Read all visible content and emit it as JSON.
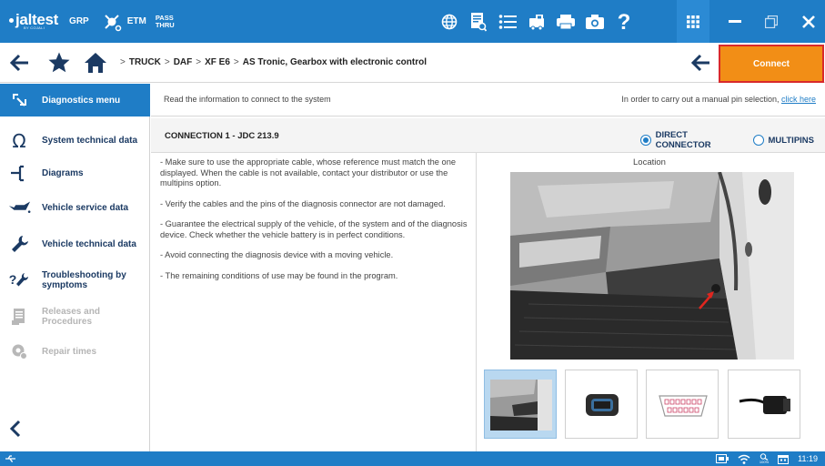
{
  "topbar": {
    "logo_text": "jaltest",
    "logo_sub": "BY COJALI",
    "grp_label": "GRP",
    "etm_label": "ETM",
    "pass_line1": "PASS",
    "pass_line2": "THRU",
    "accent": "#1f7dc6"
  },
  "nav": {
    "crumb1": "TRUCK",
    "crumb2": "DAF",
    "crumb3": "XF E6",
    "crumb4": "AS Tronic, Gearbox with electronic control",
    "separator": ">",
    "connect_label": "Connect",
    "connect_color": "#f28e16"
  },
  "sidebar": {
    "items": [
      {
        "label": "Diagnostics menu",
        "icon": "diagnostics-icon"
      },
      {
        "label": "System technical data",
        "icon": "ohm-icon"
      },
      {
        "label": "Diagrams",
        "icon": "diagram-icon"
      },
      {
        "label": "Vehicle service data",
        "icon": "oil-can-icon"
      },
      {
        "label": "Vehicle technical data",
        "icon": "wrench-icon"
      },
      {
        "label": "Troubleshooting by symptoms",
        "icon": "troubleshooting-icon"
      },
      {
        "label": "Releases and Procedures",
        "icon": "document-icon"
      },
      {
        "label": "Repair times",
        "icon": "gear-clock-icon"
      }
    ]
  },
  "info": {
    "left": "Read the information to connect to the system",
    "right_prefix": "In order to carry out a manual pin selection, ",
    "right_link": "click here"
  },
  "connection": {
    "title": "CONNECTION 1 - JDC 213.9",
    "option_direct": "DIRECT CONNECTOR",
    "option_multipins": "MULTIPINS",
    "selected": "DIRECT CONNECTOR"
  },
  "instructions": [
    "- Make sure to use the appropriate cable, whose reference must match the one displayed. When the cable is not available, contact your distributor or use the multipins option.",
    "- Verify the cables and the pins of the diagnosis connector are not damaged.",
    "- Guarantee the electrical supply of the vehicle, of the system and of the diagnosis device. Check whether the vehicle battery is in perfect conditions.",
    "- Avoid connecting the diagnosis device with a moving vehicle.",
    "- The remaining conditions of use may be found in the program."
  ],
  "location_label": "Location",
  "status": {
    "time": "11:19",
    "battery_label": "100%"
  }
}
